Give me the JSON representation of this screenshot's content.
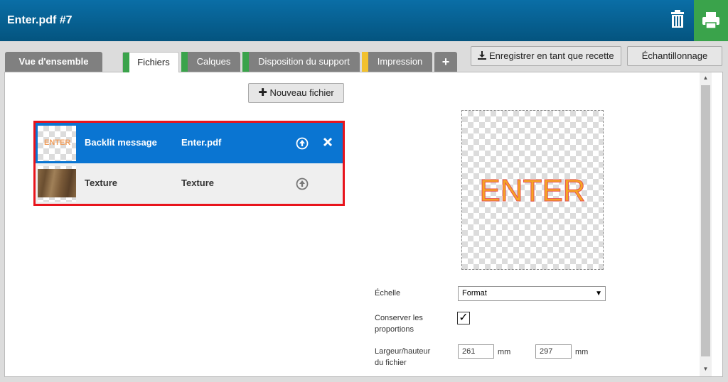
{
  "header": {
    "title": "Enter.pdf #7"
  },
  "tabs": [
    {
      "label": "Vue d'ensemble"
    },
    {
      "label": "Fichiers"
    },
    {
      "label": "Calques"
    },
    {
      "label": "Disposition du support"
    },
    {
      "label": "Impression"
    }
  ],
  "tab_plus": "+",
  "toolbar": {
    "save_recipe": "Enregistrer en tant que recette",
    "sampling": "Échantillonnage"
  },
  "files": {
    "new_file_label": "Nouveau fichier",
    "rows": [
      {
        "thumb_text": "ENTER",
        "name": "Backlit message",
        "file": "Enter.pdf",
        "selected": true
      },
      {
        "name": "Texture",
        "file": "Texture",
        "selected": false
      }
    ]
  },
  "preview": {
    "text": "ENTER"
  },
  "props": {
    "scale_label": "Échelle",
    "scale_value": "Format",
    "keep_label_line1": "Conserver les",
    "keep_label_line2": "proportions",
    "keep_checked": "✓",
    "size_label_line1": "Largeur/hauteur",
    "size_label_line2": "du fichier",
    "width": "261",
    "height": "297",
    "unit": "mm"
  },
  "colors": {
    "header": "#0a6ea6",
    "print_button": "#3aa34b",
    "selected_row": "#0a75d2",
    "highlight": "#e8141c",
    "stripe_green": "#3aa34b",
    "stripe_yellow": "#f2c12e"
  }
}
